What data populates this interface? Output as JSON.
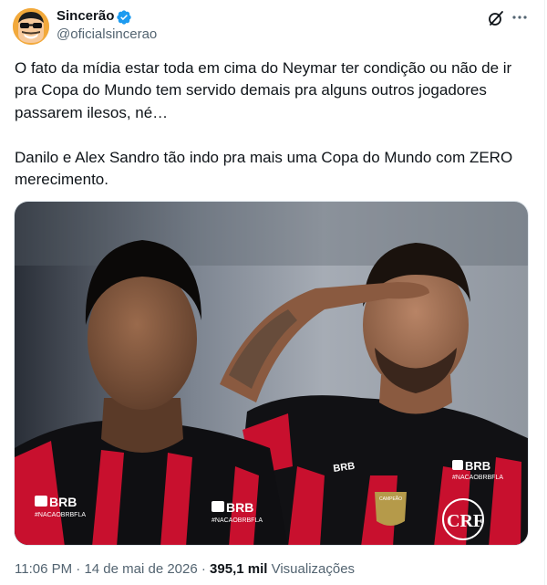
{
  "author": {
    "display_name": "Sincerão",
    "handle": "@oficialsincerao",
    "verified": true,
    "avatar_icon": "cartoon-face-sunglasses-avatar"
  },
  "header_actions": {
    "grok_icon": "grok-icon",
    "more_icon": "more-options-icon"
  },
  "tweet": {
    "paragraphs": [
      "O fato da mídia estar toda em cima do Neymar ter condição ou não de ir pra Copa do Mundo tem servido demais pra alguns outros jogadores passarem ilesos, né…",
      "Danilo e Alex Sandro tão indo pra mais uma Copa do Mundo com ZERO merecimento."
    ]
  },
  "media": {
    "kind": "photo",
    "left_shirt_sponsor": "BRB",
    "left_shirt_hashtag": "#NACAOBRBFLA",
    "right_shirt_sponsor": "BRB",
    "right_shirt_hashtag": "#NACAOBRBFLA",
    "crest_text": "CRF",
    "patch_text": "CAMPEÃO"
  },
  "meta": {
    "time": "11:06 PM",
    "separator": "·",
    "date": "14 de mai de 2026",
    "views_count": "395,1 mil",
    "views_label": "Visualizações"
  },
  "colors": {
    "text": "#0f1419",
    "secondary": "#536471",
    "verified": "#1d9bf0",
    "flamengo_red": "#c8102e"
  }
}
